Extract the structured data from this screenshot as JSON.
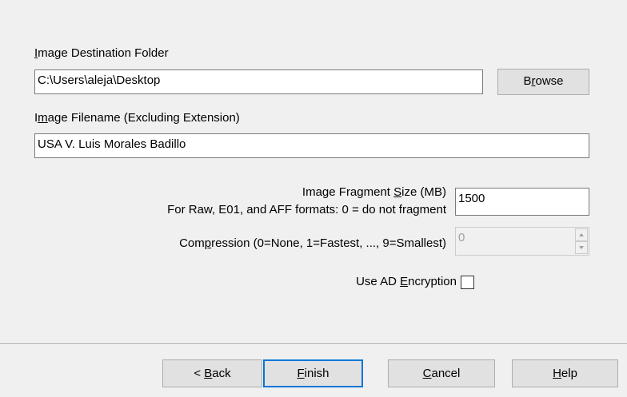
{
  "destination": {
    "label_pre": "",
    "label_ul": "I",
    "label_post": "mage Destination Folder",
    "value": "C:\\Users\\aleja\\Desktop",
    "browse_pre": "B",
    "browse_ul": "r",
    "browse_post": "owse"
  },
  "filename": {
    "label_pre": "I",
    "label_ul": "m",
    "label_post": "age Filename (Excluding Extension)",
    "value": "USA V. Luis Morales Badillo"
  },
  "fragment": {
    "label_line1_pre": "Image Fragment ",
    "label_line1_ul": "S",
    "label_line1_post": "ize (MB)",
    "label_line2": "For Raw, E01, and AFF formats: 0 = do not fragment",
    "value": "1500"
  },
  "compression": {
    "label_pre": "Com",
    "label_ul": "p",
    "label_post": "ression (0=None, 1=Fastest, ..., 9=Smallest)",
    "value": "0"
  },
  "encryption": {
    "label_pre": "Use AD ",
    "label_ul": "E",
    "label_post": "ncryption",
    "checked": false
  },
  "buttons": {
    "back_pre": "< ",
    "back_ul": "B",
    "back_post": "ack",
    "finish_ul": "F",
    "finish_post": "inish",
    "cancel_ul": "C",
    "cancel_post": "ancel",
    "help_ul": "H",
    "help_post": "elp"
  }
}
